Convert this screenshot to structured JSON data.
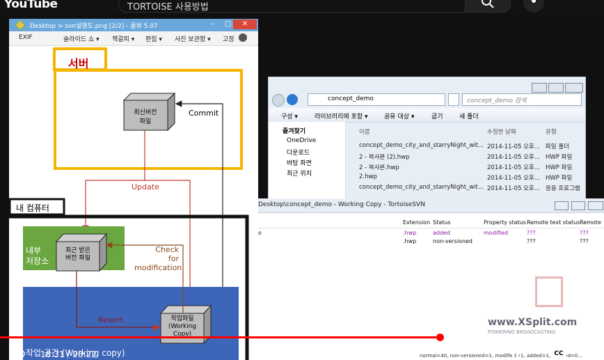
{
  "youtube": {
    "logo": "YouTube",
    "search_text": "TORTOISE 사용방법",
    "time": "18:31 / 28:22",
    "cc": "CC"
  },
  "viewer": {
    "title": "Desktop > svn설명도.png [2/2] - 꿀뷰 5.07",
    "toolbar": [
      "EXIF",
      "슬라이드 쇼 ▾",
      "책갈피 ▾",
      "편집 ▾",
      "사진 보관함 ▾",
      "고정"
    ],
    "diagram": {
      "server": "서버",
      "latest": [
        "최신버전",
        "파일"
      ],
      "commit": "Commit",
      "update": "Update",
      "my_pc": "내 컴퓨터",
      "local": [
        "내부",
        "저장소"
      ],
      "received": [
        "최근 받은",
        "버전 파일"
      ],
      "check": [
        "Check",
        "for",
        "modification"
      ],
      "revert": "Revert",
      "work": [
        "작업파일",
        "(Working",
        "Copy)"
      ],
      "bottom": "작업 공간 (Working copy)"
    }
  },
  "explorer": {
    "path": "concept_demo",
    "search_placeholder": "concept_demo 검색",
    "commands": [
      "구성 ▾",
      "라이브러리에 포함 ▾",
      "공유 대상 ▾",
      "굽기",
      "새 폴더"
    ],
    "nav": [
      "즐겨찾기",
      "OneDrive",
      "다운로드",
      "바탕 화면",
      "최근 위치"
    ],
    "columns": [
      "이름",
      "수정한 날짜",
      "유형"
    ],
    "files": [
      {
        "name": "concept_demo_city_and_starryNight_wit...",
        "date": "2014-11-05 오후...",
        "type": "파일 폴더"
      },
      {
        "name": "2 - 복사본 (2).hwp",
        "date": "2014-11-05 오후...",
        "type": "HWP 파일"
      },
      {
        "name": "2 - 복사본.hwp",
        "date": "2014-11-05 오후...",
        "type": "HWP 파일"
      },
      {
        "name": "2.hwp",
        "date": "2014-11-05 오후...",
        "type": "HWP 파일"
      },
      {
        "name": "concept_demo_city_and_starryNight_wit...",
        "date": "2014-11-05 오후...",
        "type": "응용 프로그램"
      }
    ]
  },
  "svn": {
    "title": "Desktop\\concept_demo - Working Copy - TortoiseSVN",
    "columns": [
      "Extension",
      "Status",
      "Property status",
      "Remote text status",
      "Remote"
    ],
    "rows": [
      {
        "name": "o",
        "ext": ".hwp",
        "status": "added",
        "prop": "modified",
        "rtext": "???",
        "remote": "???"
      },
      {
        "name": "",
        "ext": ".hwp",
        "status": "non-versioned",
        "prop": "",
        "rtext": "???",
        "remote": "???"
      }
    ],
    "statusbar": "normal=40, non-versioned=1, modified=1, added=1, deleted=0...",
    "xsplit": "www.XSplit.com",
    "xsplit_sub": "POWERING BROADCASTING"
  },
  "colors": {
    "accent": "#f5b400",
    "progress": "#ff0000",
    "local_green": "#6aa741",
    "work_blue": "#3d65b8"
  }
}
